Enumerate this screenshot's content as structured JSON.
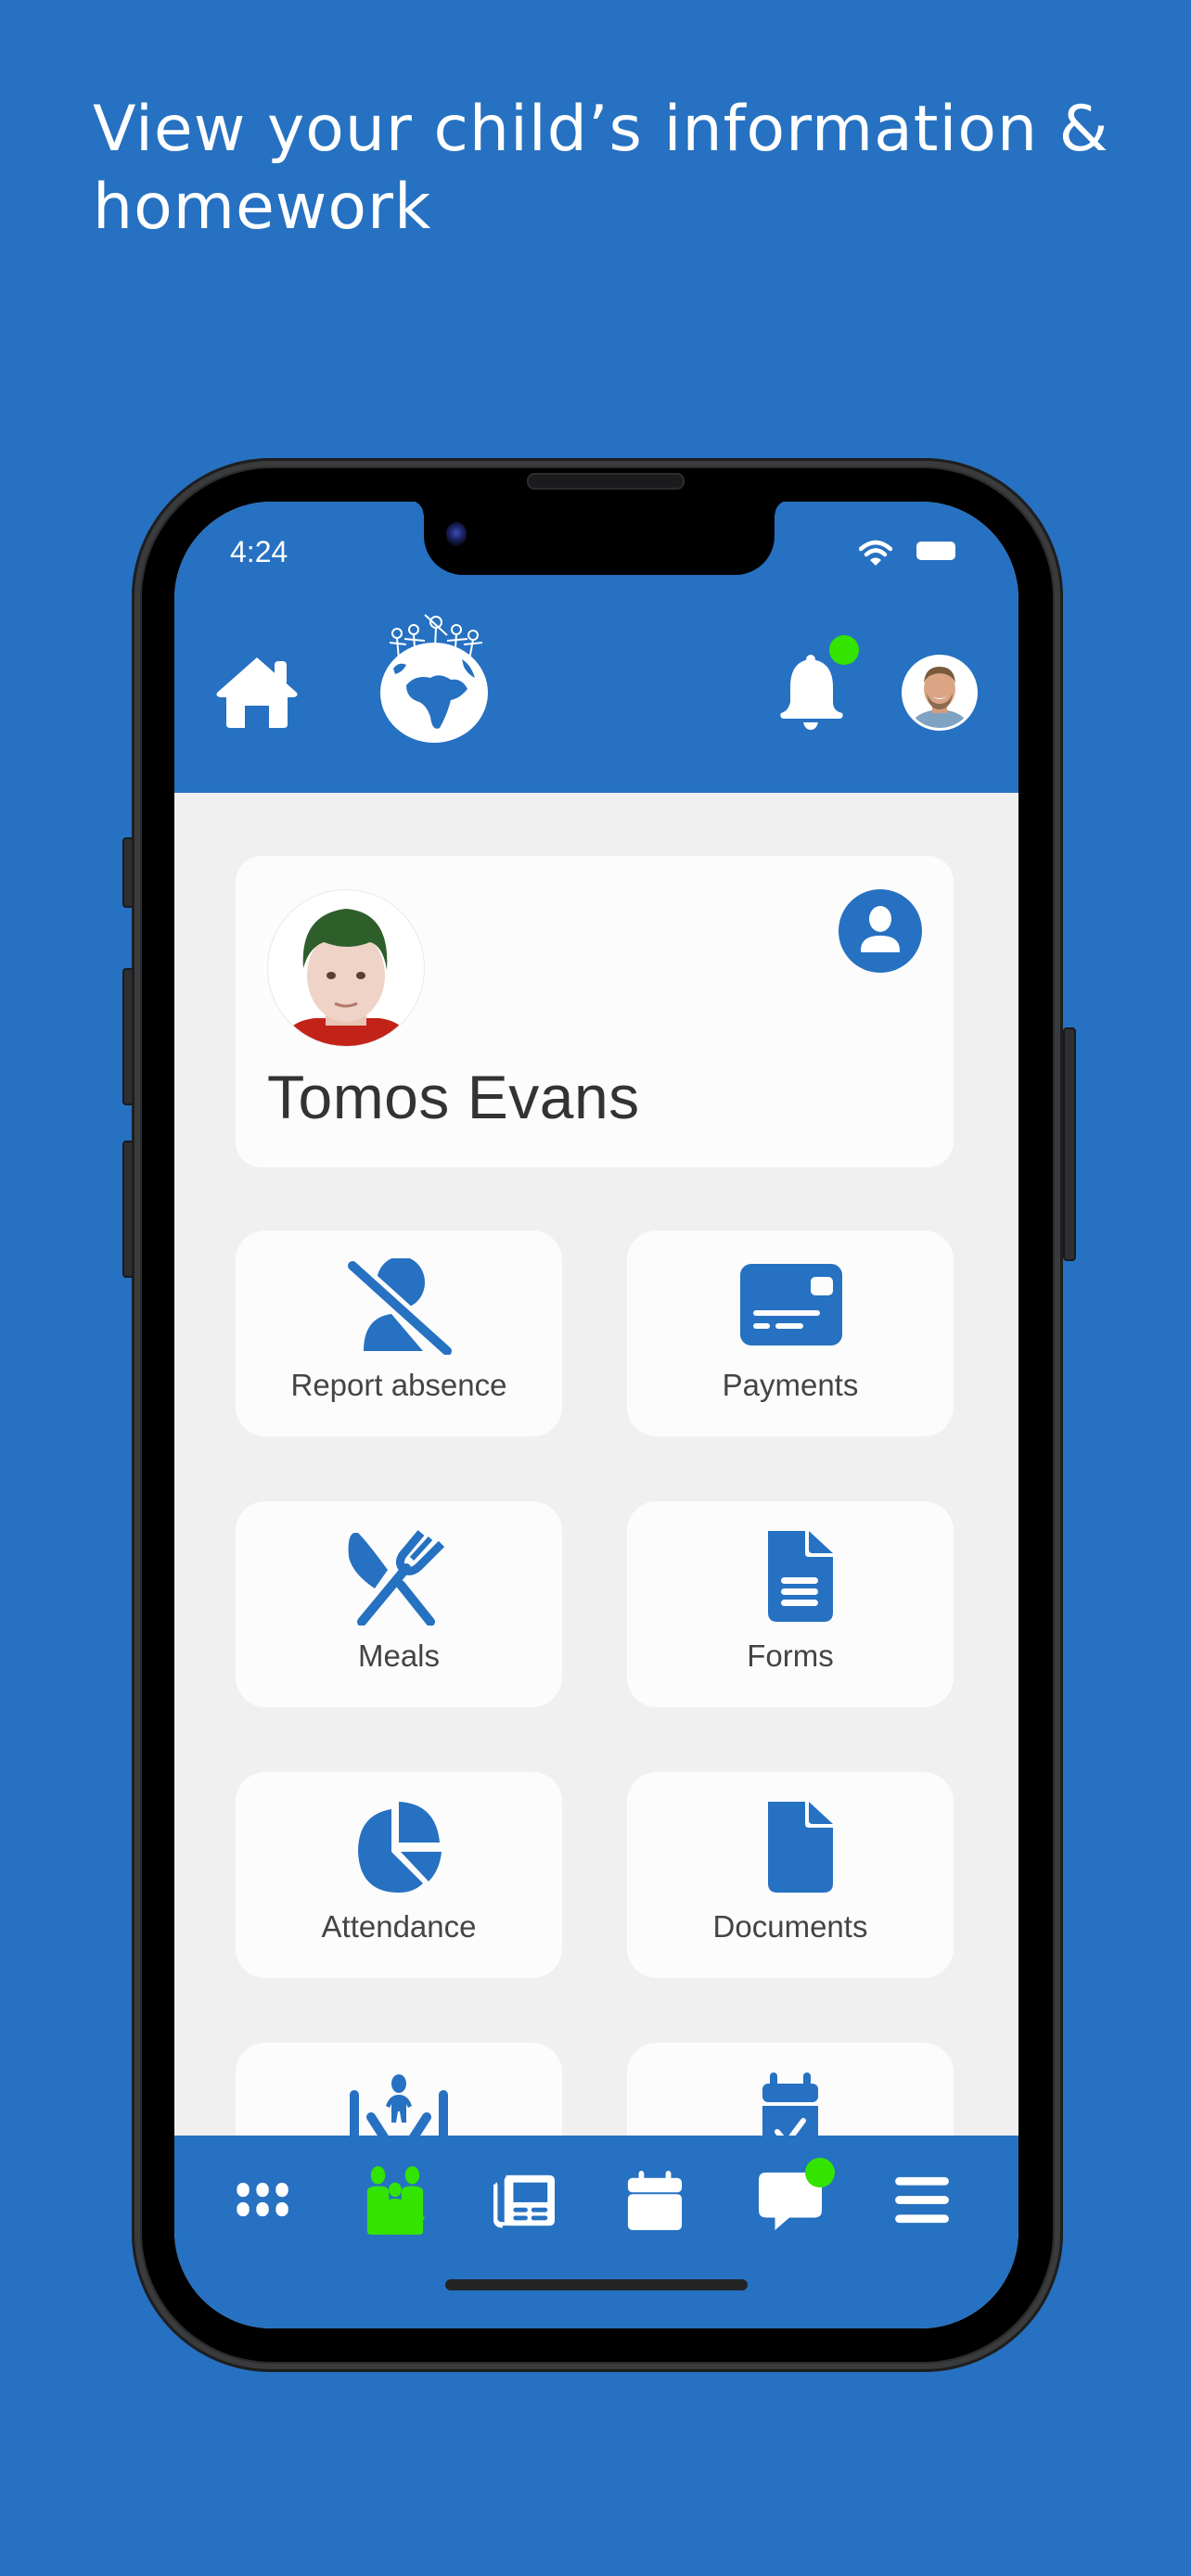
{
  "promo": {
    "headline": "View your child’s information & homework"
  },
  "status_bar": {
    "time": "4:24",
    "icons": [
      "wifi-icon",
      "battery-icon"
    ]
  },
  "header": {
    "left_icon": "home-icon",
    "logo": "globe-children-logo",
    "notification_icon": "bell-icon",
    "notification_badge": true,
    "avatar": "parent-avatar"
  },
  "child": {
    "name": "Tomos Evans",
    "profile_icon": "user-icon"
  },
  "tiles": [
    {
      "label": "Report absence",
      "icon": "user-slash-icon"
    },
    {
      "label": "Payments",
      "icon": "credit-card-icon"
    },
    {
      "label": "Meals",
      "icon": "utensils-icon"
    },
    {
      "label": "Forms",
      "icon": "file-lines-icon"
    },
    {
      "label": "Attendance",
      "icon": "pie-chart-icon"
    },
    {
      "label": "Documents",
      "icon": "file-icon"
    },
    {
      "label": "",
      "icon": "child-care-icon"
    },
    {
      "label": "",
      "icon": "calendar-check-icon"
    }
  ],
  "bottom_nav": [
    {
      "name": "apps",
      "icon": "grid-icon",
      "active": false
    },
    {
      "name": "family",
      "icon": "family-icon",
      "active": true
    },
    {
      "name": "news",
      "icon": "newspaper-icon",
      "active": false
    },
    {
      "name": "calendar",
      "icon": "calendar-icon",
      "active": false
    },
    {
      "name": "messages",
      "icon": "message-icon",
      "active": false,
      "badge": true
    },
    {
      "name": "menu",
      "icon": "menu-icon",
      "active": false
    }
  ],
  "colors": {
    "brand_blue": "#2671c1",
    "accent_green": "#33e400",
    "content_bg": "#f0f0f0",
    "card_bg": "#fcfcfc",
    "text_dark": "#333333"
  }
}
